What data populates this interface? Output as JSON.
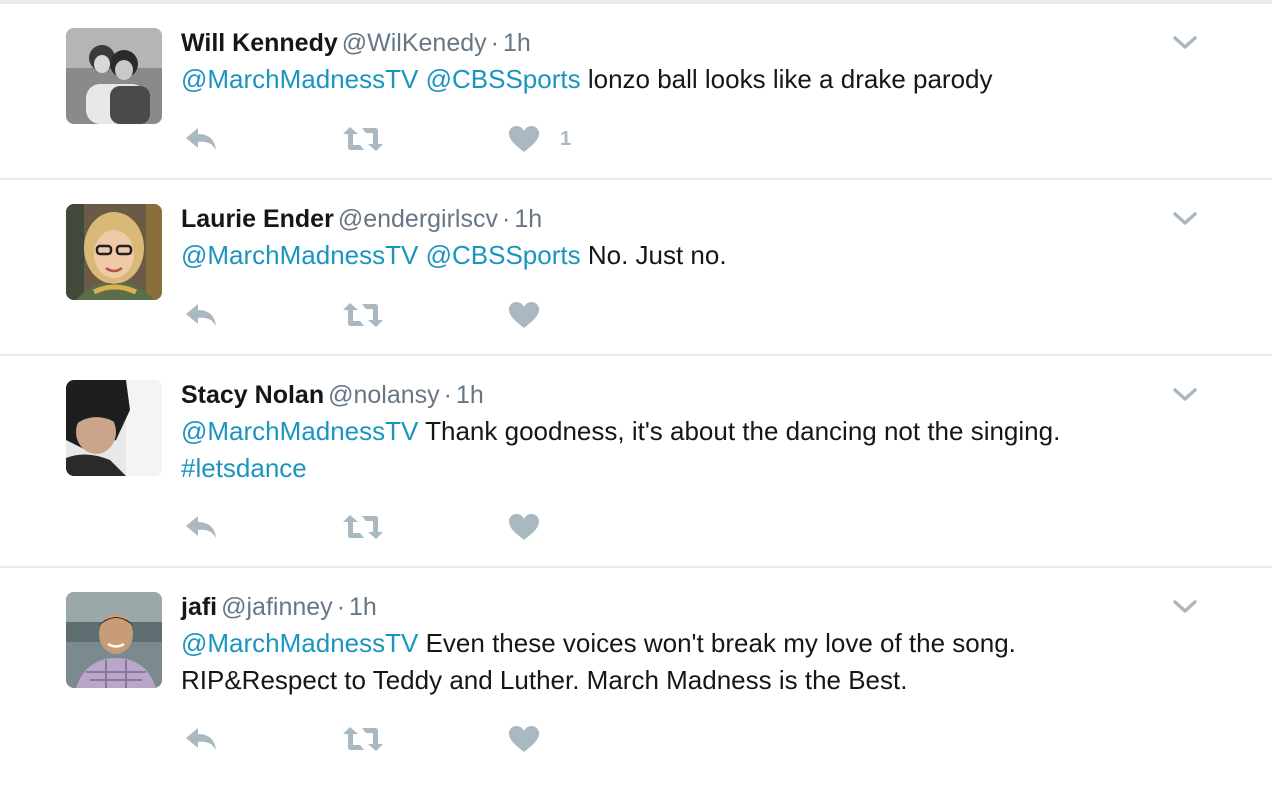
{
  "tweets": [
    {
      "fullname": "Will Kennedy",
      "username": "@WilKenedy",
      "separator": "·",
      "time": "1h",
      "mentions": [
        "@MarchMadnessTV",
        "@CBSSports"
      ],
      "text": "lonzo ball looks like a drake parody",
      "like_count": "1"
    },
    {
      "fullname": "Laurie Ender",
      "username": "@endergirlscv",
      "separator": "·",
      "time": "1h",
      "mentions": [
        "@MarchMadnessTV",
        "@CBSSports"
      ],
      "text": "No. Just no.",
      "like_count": ""
    },
    {
      "fullname": "Stacy Nolan",
      "username": "@nolansy",
      "separator": "·",
      "time": "1h",
      "mentions": [
        "@MarchMadnessTV"
      ],
      "text": "Thank goodness, it's about the dancing not the singing.",
      "hashtag": "#letsdance",
      "like_count": ""
    },
    {
      "fullname": "jafi",
      "username": "@jafinney",
      "separator": "·",
      "time": "1h",
      "mentions": [
        "@MarchMadnessTV"
      ],
      "text": "Even these voices won't break my love of the song.",
      "text_line2": "RIP&Respect to Teddy and Luther. March Madness is the Best.",
      "like_count": ""
    }
  ],
  "icons": {
    "reply": "reply-icon",
    "retweet": "retweet-icon",
    "like": "heart-icon",
    "menu": "chevron-down-icon"
  },
  "colors": {
    "link": "#1b95c0",
    "secondary_text": "#657786",
    "icon": "#aab8c2",
    "divider": "#e6ecf0"
  }
}
